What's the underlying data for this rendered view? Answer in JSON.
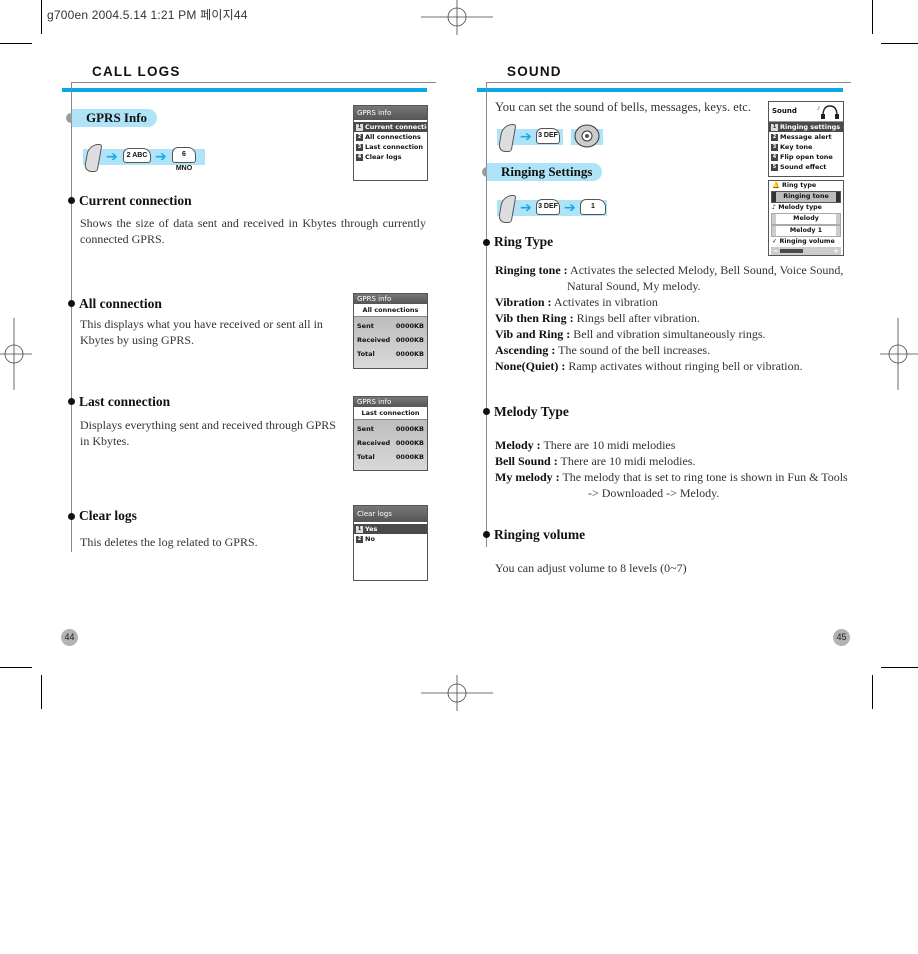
{
  "print_header": "g700en  2004.5.14 1:21 PM 페이지44",
  "left_page": {
    "section_title": "CALL LOGS",
    "subsection": "GPRS Info",
    "key_sequence": [
      "MENU",
      "2 ABC",
      "6 MNO"
    ],
    "gprs_menu_screen": {
      "title": "GPRS info",
      "items": [
        {
          "num": "1",
          "label": "Current connectio",
          "selected": true
        },
        {
          "num": "2",
          "label": "All connections",
          "selected": false
        },
        {
          "num": "3",
          "label": "Last connection",
          "selected": false
        },
        {
          "num": "4",
          "label": "Clear logs",
          "selected": false
        }
      ]
    },
    "items": [
      {
        "heading": "Current connection",
        "text": "Shows the size of data sent and received in Kbytes through currently connected GPRS."
      },
      {
        "heading": "All connection",
        "text": "This displays what you have received or sent all in Kbytes by using GPRS."
      },
      {
        "heading": "Last connection",
        "text": "Displays everything sent and received through GPRS in Kbytes."
      },
      {
        "heading": "Clear logs",
        "text": "This deletes the log related to GPRS."
      }
    ],
    "all_conn_screen": {
      "title": "GPRS info",
      "subtitle": "All connections",
      "rows": [
        {
          "k": "Sent",
          "v": "0000KB"
        },
        {
          "k": "Received",
          "v": "0000KB"
        },
        {
          "k": "Total",
          "v": "0000KB"
        }
      ]
    },
    "last_conn_screen": {
      "title": "GPRS info",
      "subtitle": "Last connection",
      "rows": [
        {
          "k": "Sent",
          "v": "0000KB"
        },
        {
          "k": "Received",
          "v": "0000KB"
        },
        {
          "k": "Total",
          "v": "0000KB"
        }
      ]
    },
    "clear_screen": {
      "title": "Clear logs",
      "items": [
        {
          "num": "1",
          "label": "Yes",
          "selected": true
        },
        {
          "num": "2",
          "label": "No",
          "selected": false
        }
      ]
    },
    "page_number": "44"
  },
  "right_page": {
    "section_title": "SOUND",
    "intro": "You can set the sound of bells, messages, keys. etc.",
    "key_sequence_1": [
      "MENU",
      "3 DEF"
    ],
    "subsection": "Ringing Settings",
    "key_sequence_2": [
      "MENU",
      "3 DEF",
      "1"
    ],
    "sound_screen": {
      "title": "Sound",
      "items": [
        {
          "num": "1",
          "label": "Ringing settings",
          "selected": true
        },
        {
          "num": "2",
          "label": "Message alert",
          "selected": false
        },
        {
          "num": "3",
          "label": "Key tone",
          "selected": false
        },
        {
          "num": "4",
          "label": "Flip open tone",
          "selected": false
        },
        {
          "num": "5",
          "label": "Sound effect",
          "selected": false
        }
      ]
    },
    "ring_screen": {
      "ring_type_label": "Ring type",
      "ring_type_value": "Ringing tone",
      "melody_type_label": "Melody type",
      "melody_value_1": "Melody",
      "melody_value_2": "Melody 1",
      "volume_label": "Ringing volume",
      "volume_minus": "−",
      "volume_plus": "+",
      "volume_fraction": 0.45
    },
    "ring_type": {
      "heading": "Ring Type",
      "defs": [
        {
          "term": "Ringing tone :",
          "desc": "Activates the selected Melody, Bell Sound, Voice Sound,",
          "desc2": "Natural Sound, My melody."
        },
        {
          "term": "Vibration :",
          "desc": "Activates in vibration"
        },
        {
          "term": "Vib then Ring :",
          "desc": "Rings bell after vibration."
        },
        {
          "term": "Vib and Ring :",
          "desc": "Bell and vibration simultaneously rings."
        },
        {
          "term": "Ascending :",
          "desc": "The sound of the bell increases."
        },
        {
          "term": "None(Quiet) :",
          "desc": "Ramp activates without ringing bell or vibration."
        }
      ]
    },
    "melody_type": {
      "heading": "Melody Type",
      "defs": [
        {
          "term": "Melody :",
          "desc": "There are 10 midi melodies"
        },
        {
          "term": "Bell Sound :",
          "desc": "There are 10 midi melodies."
        },
        {
          "term": "My melody :",
          "desc": "The melody that is set to ring tone is shown in Fun & Tools",
          "desc2": "-> Downloaded -> Melody."
        }
      ]
    },
    "ringing_volume": {
      "heading": "Ringing volume",
      "text": "You can adjust volume to 8 levels (0~7)"
    },
    "page_number": "45"
  }
}
